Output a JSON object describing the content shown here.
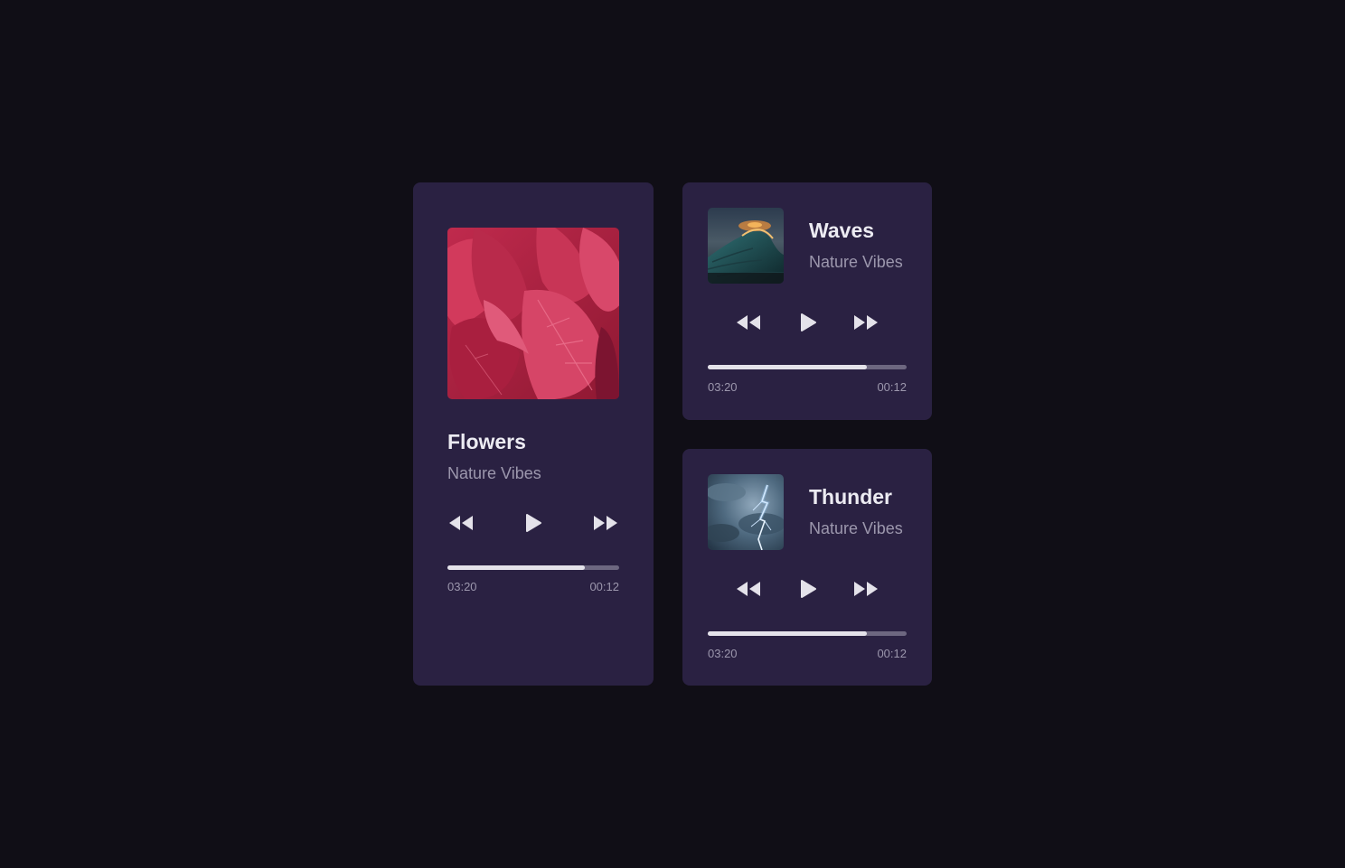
{
  "colors": {
    "background": "#100e16",
    "card": "#2a2142",
    "title": "#ecebf2",
    "secondary_text": "#9c97ad",
    "icon": "#e4e2ea",
    "progress_track": "#6d6780",
    "progress_fill": "#e4e2ea"
  },
  "icons": {
    "rewind": "rewind-icon",
    "play": "play-icon",
    "forward": "fast-forward-icon"
  },
  "players": [
    {
      "title": "Flowers",
      "artist": "Nature Vibes",
      "cover": "red leaves photo",
      "elapsed": "03:20",
      "remaining": "00:12",
      "progress": 0.8
    },
    {
      "title": "Waves",
      "artist": "Nature Vibes",
      "cover": "ocean wave at sunset photo",
      "elapsed": "03:20",
      "remaining": "00:12",
      "progress": 0.8
    },
    {
      "title": "Thunder",
      "artist": "Nature Vibes",
      "cover": "lightning storm photo",
      "elapsed": "03:20",
      "remaining": "00:12",
      "progress": 0.8
    }
  ]
}
